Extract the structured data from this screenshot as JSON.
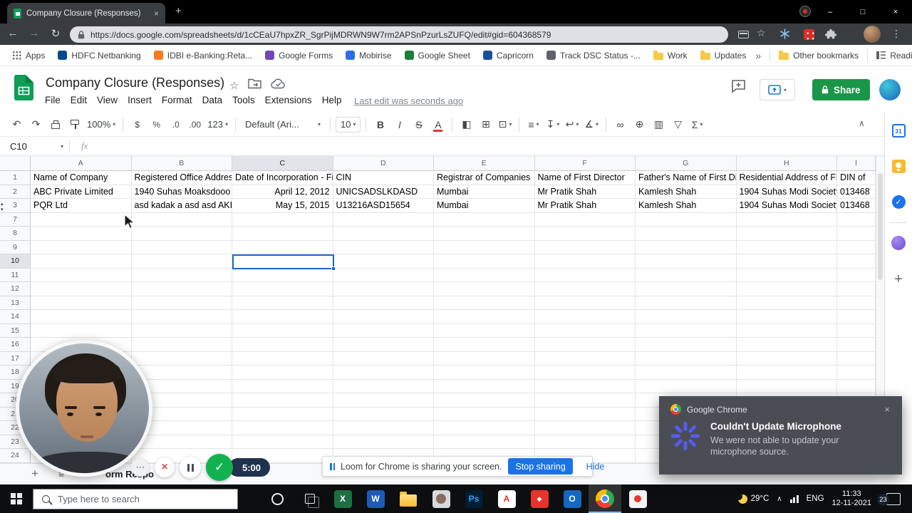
{
  "colors": {
    "accent_blue": "#1a73e8",
    "sheets_green": "#0f9d58",
    "share_green": "#1a9648",
    "selection_blue": "#1967d2",
    "chrome_red": "#ea4335",
    "chrome_yellow": "#fbbc04",
    "chrome_green": "#34a853",
    "notification_bg": "#4a4e54",
    "taskbar_bg": "#0c0e10",
    "loom_logo_blue": "#585cf6"
  },
  "browser": {
    "tab_title": "Company Closure (Responses)",
    "url": "https://docs.google.com/spreadsheets/d/1cCEaU7hpxZR_SgrPijMDRWN9W7rm2APSnPzurLsZUFQ/edit#gid=604368579",
    "bookmarks": [
      {
        "label": "Apps",
        "icon": "apps-grid",
        "color": "#5f6368"
      },
      {
        "label": "HDFC Netbanking",
        "icon": "site",
        "color": "#004c8f"
      },
      {
        "label": "IDBI e-Banking:Reta...",
        "icon": "site",
        "color": "#f47b20"
      },
      {
        "label": "Google Forms",
        "icon": "site",
        "color": "#7248b9"
      },
      {
        "label": "Mobirise",
        "icon": "site",
        "color": "#2d6fe0"
      },
      {
        "label": "Google Sheet",
        "icon": "site",
        "color": "#188038"
      },
      {
        "label": "Capricorn",
        "icon": "site",
        "color": "#1b4f9c"
      },
      {
        "label": "Track DSC Status -...",
        "icon": "site",
        "color": "#5f6368"
      },
      {
        "label": "Work",
        "icon": "folder",
        "color": "#f7c948"
      },
      {
        "label": "Updates",
        "icon": "folder",
        "color": "#f7c948"
      }
    ],
    "bookmarks_overflow": "»",
    "other_bookmarks_label": "Other bookmarks",
    "reading_list_label": "Reading list"
  },
  "sheets": {
    "doc_title": "Company Closure (Responses)",
    "menu_items": [
      "File",
      "Edit",
      "View",
      "Insert",
      "Format",
      "Data",
      "Tools",
      "Extensions",
      "Help"
    ],
    "last_edit_label": "Last edit was seconds ago",
    "share_label": "Share",
    "name_box_value": "C10",
    "fx_label": "fx",
    "toolbar": {
      "zoom": "100%",
      "number_format": "123",
      "font_name": "Default (Ari...",
      "font_size": "10"
    },
    "toolbar_icons": [
      "undo-icon",
      "redo-icon",
      "print-icon",
      "paint-format-icon",
      "zoom-select",
      "divider",
      "currency-icon",
      "percent-icon",
      "decrease-decimal-icon",
      "increase-decimal-icon",
      "number-format-select",
      "divider",
      "font-name-select",
      "divider",
      "font-size-select",
      "divider",
      "bold-icon",
      "italic-icon",
      "strikethrough-icon",
      "text-color-icon",
      "divider",
      "fill-color-icon",
      "borders-icon",
      "merge-cells-icon",
      "divider",
      "horizontal-align-icon",
      "vertical-align-icon",
      "text-wrap-icon",
      "text-rotation-icon",
      "divider",
      "insert-link-icon",
      "insert-comment-icon",
      "insert-chart-icon",
      "create-filter-icon",
      "functions-icon"
    ],
    "column_letters": [
      "A",
      "B",
      "C",
      "D",
      "E",
      "F",
      "G",
      "H",
      "I"
    ],
    "selected_column": "C",
    "selected_row": "10",
    "row_numbers": [
      "1",
      "2",
      "3",
      "7",
      "8",
      "9",
      "10",
      "11",
      "12",
      "13",
      "14",
      "15",
      "16",
      "17",
      "18",
      "19",
      "20",
      "21",
      "22",
      "23",
      "24"
    ],
    "table": {
      "header_row": [
        "Name of Company",
        "Registered Office Addres",
        "Date of Incorporation - Fi",
        "CIN",
        "Registrar of Companies",
        "Name of First Director",
        "Father's Name of First Di",
        "Residential Address of Fi",
        "DIN of"
      ],
      "data_rows": [
        [
          "ABC Private Limited",
          "1940 Suhas Moaksdooo",
          "April 12, 2012",
          "UNICSADSLKDASD",
          "Mumbai",
          "Mr Pratik Shah",
          "Kamlesh Shah",
          "1904 Suhas Modi Society",
          "013468"
        ],
        [
          "PQR Ltd",
          "asd kadak a asd asd AKI",
          "May 15, 2015",
          "U13216ASD15654",
          "Mumbai",
          "Mr Pratik Shah",
          "Kamlesh Shah",
          "1904 Suhas Modi Society",
          "013468"
        ]
      ]
    },
    "sheet_tab_label": "orm Respo",
    "side_panel_icons": [
      "google-calendar",
      "google-keep",
      "google-tasks",
      "addon",
      "get-addons"
    ]
  },
  "loom": {
    "timer": "5:00",
    "share_bar_text": "Loom for Chrome is sharing your screen.",
    "stop_sharing_label": "Stop sharing",
    "hide_label": "Hide"
  },
  "notification": {
    "app_name": "Google Chrome",
    "title": "Couldn't Update Microphone",
    "body": "We were not able to update your microphone source."
  },
  "taskbar": {
    "search_placeholder": "Type here to search",
    "app_icons": [
      "cortana",
      "task-view",
      "excel",
      "word",
      "file-explorer",
      "generic-app",
      "photoshop",
      "acrobat",
      "adobe",
      "outlook",
      "chrome",
      "recorder"
    ],
    "active_app": "chrome",
    "temperature": "29°C",
    "language": "ENG",
    "time": "11:33",
    "date": "12-11-2021",
    "notification_count": "23"
  }
}
